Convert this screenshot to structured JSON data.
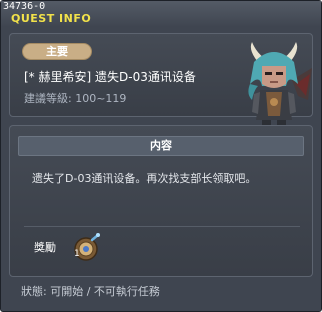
{
  "window": {
    "quest_id": "34736-0",
    "title": "QUEST INFO"
  },
  "quest": {
    "category": "主要",
    "name": "[* 赫里希安] 遗失D-03通讯设备",
    "recommended_level": "建議等級: 100~119"
  },
  "content": {
    "header": "内容",
    "text": "遗失了D-03通讯设备。再次找支部长领取吧。"
  },
  "reward": {
    "label": "獎勵",
    "count": "1"
  },
  "status": {
    "text": "狀態: 可開始 / 不可執行任務"
  },
  "icons": {
    "npc": "npc-portrait-icon",
    "reward_item": "compass-device-icon"
  }
}
